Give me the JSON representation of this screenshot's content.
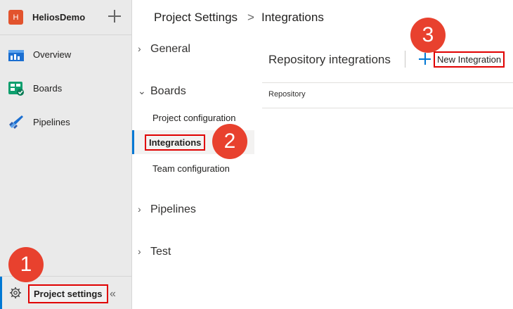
{
  "org": {
    "initial": "H",
    "name": "HeliosDemo"
  },
  "nav": {
    "items": [
      {
        "label": "Overview",
        "icon": "overview-icon"
      },
      {
        "label": "Boards",
        "icon": "boards-icon"
      },
      {
        "label": "Pipelines",
        "icon": "pipelines-icon"
      }
    ],
    "settings_label": "Project settings",
    "collapse_glyph": "«"
  },
  "breadcrumb": {
    "root": "Project Settings",
    "separator": ">",
    "current": "Integrations"
  },
  "settings_menu": {
    "sections": [
      {
        "label": "General",
        "expanded": false
      },
      {
        "label": "Boards",
        "expanded": true,
        "items": [
          "Project configuration",
          "Integrations",
          "Team configuration"
        ],
        "selected": "Integrations"
      },
      {
        "label": "Pipelines",
        "expanded": false
      },
      {
        "label": "Test",
        "expanded": false
      }
    ]
  },
  "main": {
    "title": "Repository integrations",
    "new_button": "New Integration",
    "columns": [
      "Repository"
    ]
  },
  "steps": [
    "1",
    "2",
    "3"
  ],
  "colors": {
    "accent": "#0078d4",
    "highlight": "#e00000",
    "badge": "#e8412e",
    "org": "#e2532d"
  }
}
